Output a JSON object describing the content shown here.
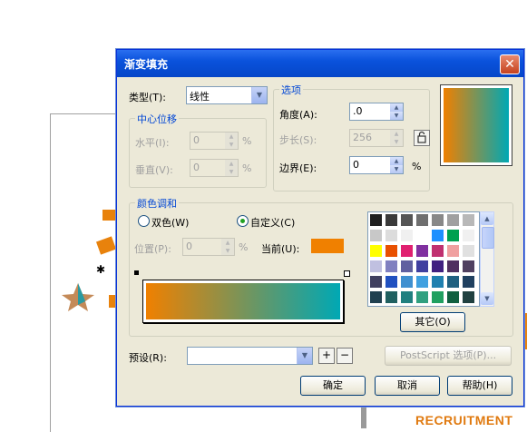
{
  "background": {
    "logo_text": "RECRUITMENT",
    "partial_letter": "R"
  },
  "dialog": {
    "title": "渐变填充",
    "close_glyph": "✕",
    "type_label": "类型(T):",
    "type_value": "线性",
    "center_offset": {
      "title": "中心位移",
      "horizontal_label": "水平(I):",
      "horizontal_value": "0",
      "vertical_label": "垂直(V):",
      "vertical_value": "0",
      "unit": "%"
    },
    "options": {
      "title": "选项",
      "angle_label": "角度(A):",
      "angle_value": ".0",
      "steps_label": "步长(S):",
      "steps_value": "256",
      "edge_label": "边界(E):",
      "edge_value": "0",
      "unit": "%"
    },
    "color_blend": {
      "title": "颜色调和",
      "two_color_label": "双色(W)",
      "custom_label": "自定义(C)",
      "selected_mode": "custom",
      "position_label": "位置(P):",
      "position_value": "0",
      "unit": "%",
      "current_label": "当前(U):",
      "current_color": "#f08000",
      "gradient_start": "#f08000",
      "gradient_end": "#00a8b4",
      "other_button": "其它(O)"
    },
    "palette": [
      "#202020",
      "#3a3a3a",
      "#555555",
      "#6f6f6f",
      "#888888",
      "#a0a0a0",
      "#b8b8b8",
      "#c8c8c8",
      "#dcdcdc",
      "#f0f0f0",
      "#ffffff",
      "#1e90ff",
      "#00a050",
      "#f0f0f0",
      "#ffff00",
      "#e85000",
      "#e02070",
      "#8030a0",
      "#c03070",
      "#f0a0a0",
      "#e0e0e0",
      "#c0c0e0",
      "#8080c0",
      "#6060a0",
      "#4040a0",
      "#402080",
      "#503060",
      "#504060",
      "#404060",
      "#2050c0",
      "#4090d0",
      "#40a0e0",
      "#2080b0",
      "#206080",
      "#204060",
      "#204050",
      "#206060",
      "#208080",
      "#30a080",
      "#20a060",
      "#106040",
      "#204040"
    ],
    "preset_label": "预设(R):",
    "preset_value": "",
    "postscript_button": "PostScript 选项(P)...",
    "ok_button": "确定",
    "cancel_button": "取消",
    "help_button": "帮助(H)"
  }
}
